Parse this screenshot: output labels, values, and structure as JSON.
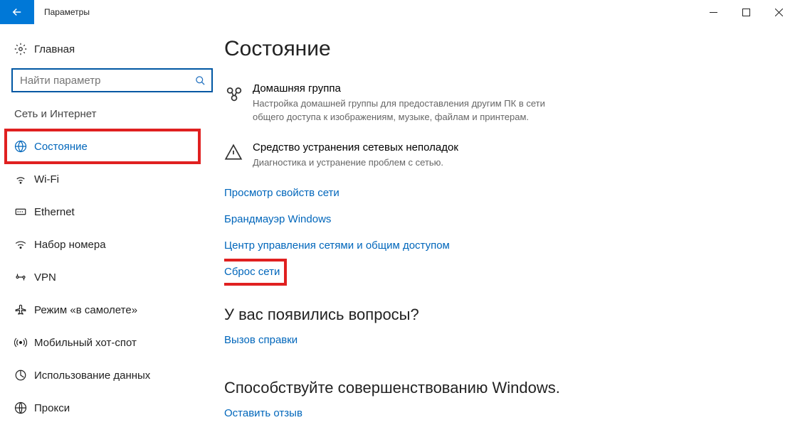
{
  "window": {
    "title": "Параметры"
  },
  "sidebar": {
    "home_label": "Главная",
    "search_placeholder": "Найти параметр",
    "category_label": "Сеть и Интернет",
    "items": [
      {
        "label": "Состояние"
      },
      {
        "label": "Wi-Fi"
      },
      {
        "label": "Ethernet"
      },
      {
        "label": "Набор номера"
      },
      {
        "label": "VPN"
      },
      {
        "label": "Режим «в самолете»"
      },
      {
        "label": "Мобильный хот-спот"
      },
      {
        "label": "Использование данных"
      },
      {
        "label": "Прокси"
      }
    ]
  },
  "main": {
    "page_title": "Состояние",
    "homegroup": {
      "title": "Домашняя группа",
      "desc": "Настройка домашней группы для предоставления другим ПК в сети общего доступа к изображениям, музыке, файлам и принтерам."
    },
    "troubleshoot": {
      "title": "Средство устранения сетевых неполадок",
      "desc": "Диагностика и устранение проблем с сетью."
    },
    "links": {
      "view_props": "Просмотр свойств сети",
      "firewall": "Брандмауэр Windows",
      "share_center": "Центр управления сетями и общим доступом",
      "reset": "Сброс сети"
    },
    "questions": {
      "title": "У вас появились вопросы?",
      "help": "Вызов справки"
    },
    "feedback": {
      "title": "Способствуйте совершенствованию Windows.",
      "link": "Оставить отзыв"
    }
  }
}
